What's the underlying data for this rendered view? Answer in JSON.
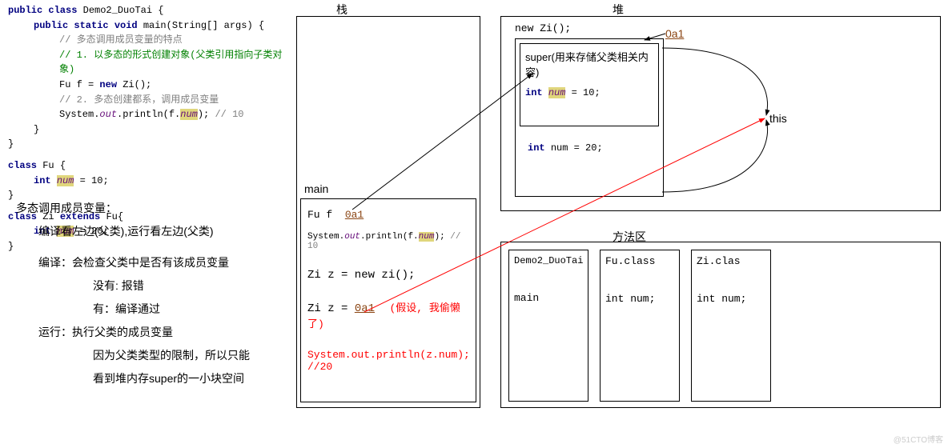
{
  "code": {
    "l1_a": "public class",
    "l1_b": "Demo2_DuoTai {",
    "l2_a": "public static void",
    "l2_b": "main(String[] args) {",
    "c1": "// 多态调用成员变量的特点",
    "c2": "// 1. 以多态的形式创建对象(父类引用指向子类对象)",
    "l3_a": "Fu f = ",
    "l3_b": "new",
    "l3_c": " Zi();",
    "c3": "// 2. 多态创建都系，调用成员变量",
    "l4_a": "System.",
    "l4_b": "out",
    "l4_c": ".println(f.",
    "l4_d": "num",
    "l4_e": ");  ",
    "l4_f": "// 10",
    "rb": "}",
    "fu_a": "class",
    "fu_b": "Fu {",
    "fu_c": "int",
    "fu_d": "num",
    "fu_e": " = ",
    "fu_v": "10",
    "fu_f": ";",
    "zi_a": "class",
    "zi_b": "Zi ",
    "zi_c": "extends",
    "zi_d": " Fu{",
    "zi_e": "int",
    "zi_f": "num",
    "zi_g": " = ",
    "zi_v": "20",
    "zi_h": ";"
  },
  "notes": {
    "title": "多态调用成员变量：",
    "n1": "编译看左边(父类),运行看左边(父类)",
    "n2": "编译：会检查父类中是否有该成员变量",
    "n2a": "没有: 报错",
    "n2b": "有：编译通过",
    "n3": "运行：执行父类的成员变量",
    "n3a": "因为父类类型的限制，所以只能",
    "n3b": "看到堆内存super的一小块空间"
  },
  "stack": {
    "title": "栈",
    "main": "main",
    "fu_f": "Fu f",
    "addr": "0a1",
    "println_a": "System.",
    "println_b": "out",
    "println_c": ".println(f.",
    "println_d": "num",
    "println_e": ");  ",
    "println_f": "// 10",
    "ziz": "Zi z = new zi();",
    "ziz2_a": "Zi z = ",
    "ziz2_b": "0a1",
    "ziz2_note": "(假设, 我偷懒了)",
    "sop2": "System.out.println(z.num); //20"
  },
  "heap": {
    "title": "堆",
    "newzi": "new Zi();",
    "addr": "0a1",
    "super_title": "super(用来存储父类相关内容)",
    "super_int": "int",
    "super_num": "num",
    "super_eq": " = ",
    "super_v": "10",
    "super_sc": ";",
    "zi_int": "int num = ",
    "zi_v": "20",
    "zi_sc": ";",
    "this": "this"
  },
  "method": {
    "title": "方法区",
    "b1_t": "Demo2_DuoTai",
    "b1_m": "main",
    "b2_t": "Fu.class",
    "b2_m": "int num;",
    "b3_t": "Zi.clas",
    "b3_m": "int num;"
  },
  "watermark": "@51CTO博客"
}
